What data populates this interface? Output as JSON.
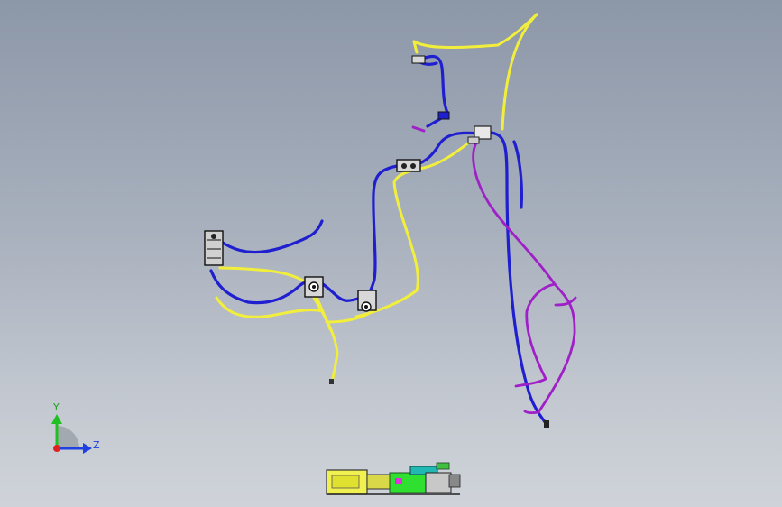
{
  "viewport": {
    "background_top": "#8c97a8",
    "background_bottom": "#cfd3d9"
  },
  "harness": {
    "colors": {
      "blue": "#1f1fd0",
      "yellow": "#f2ee3c",
      "purple": "#a020c8",
      "connector": "#e8e8e8"
    }
  },
  "triad": {
    "y_label": "Y",
    "z_label": "Z",
    "y_color": "#20c020",
    "z_color": "#2040e0",
    "origin_color": "#e02020"
  },
  "model_icons": {
    "icon": "assembly-preview-icon"
  }
}
